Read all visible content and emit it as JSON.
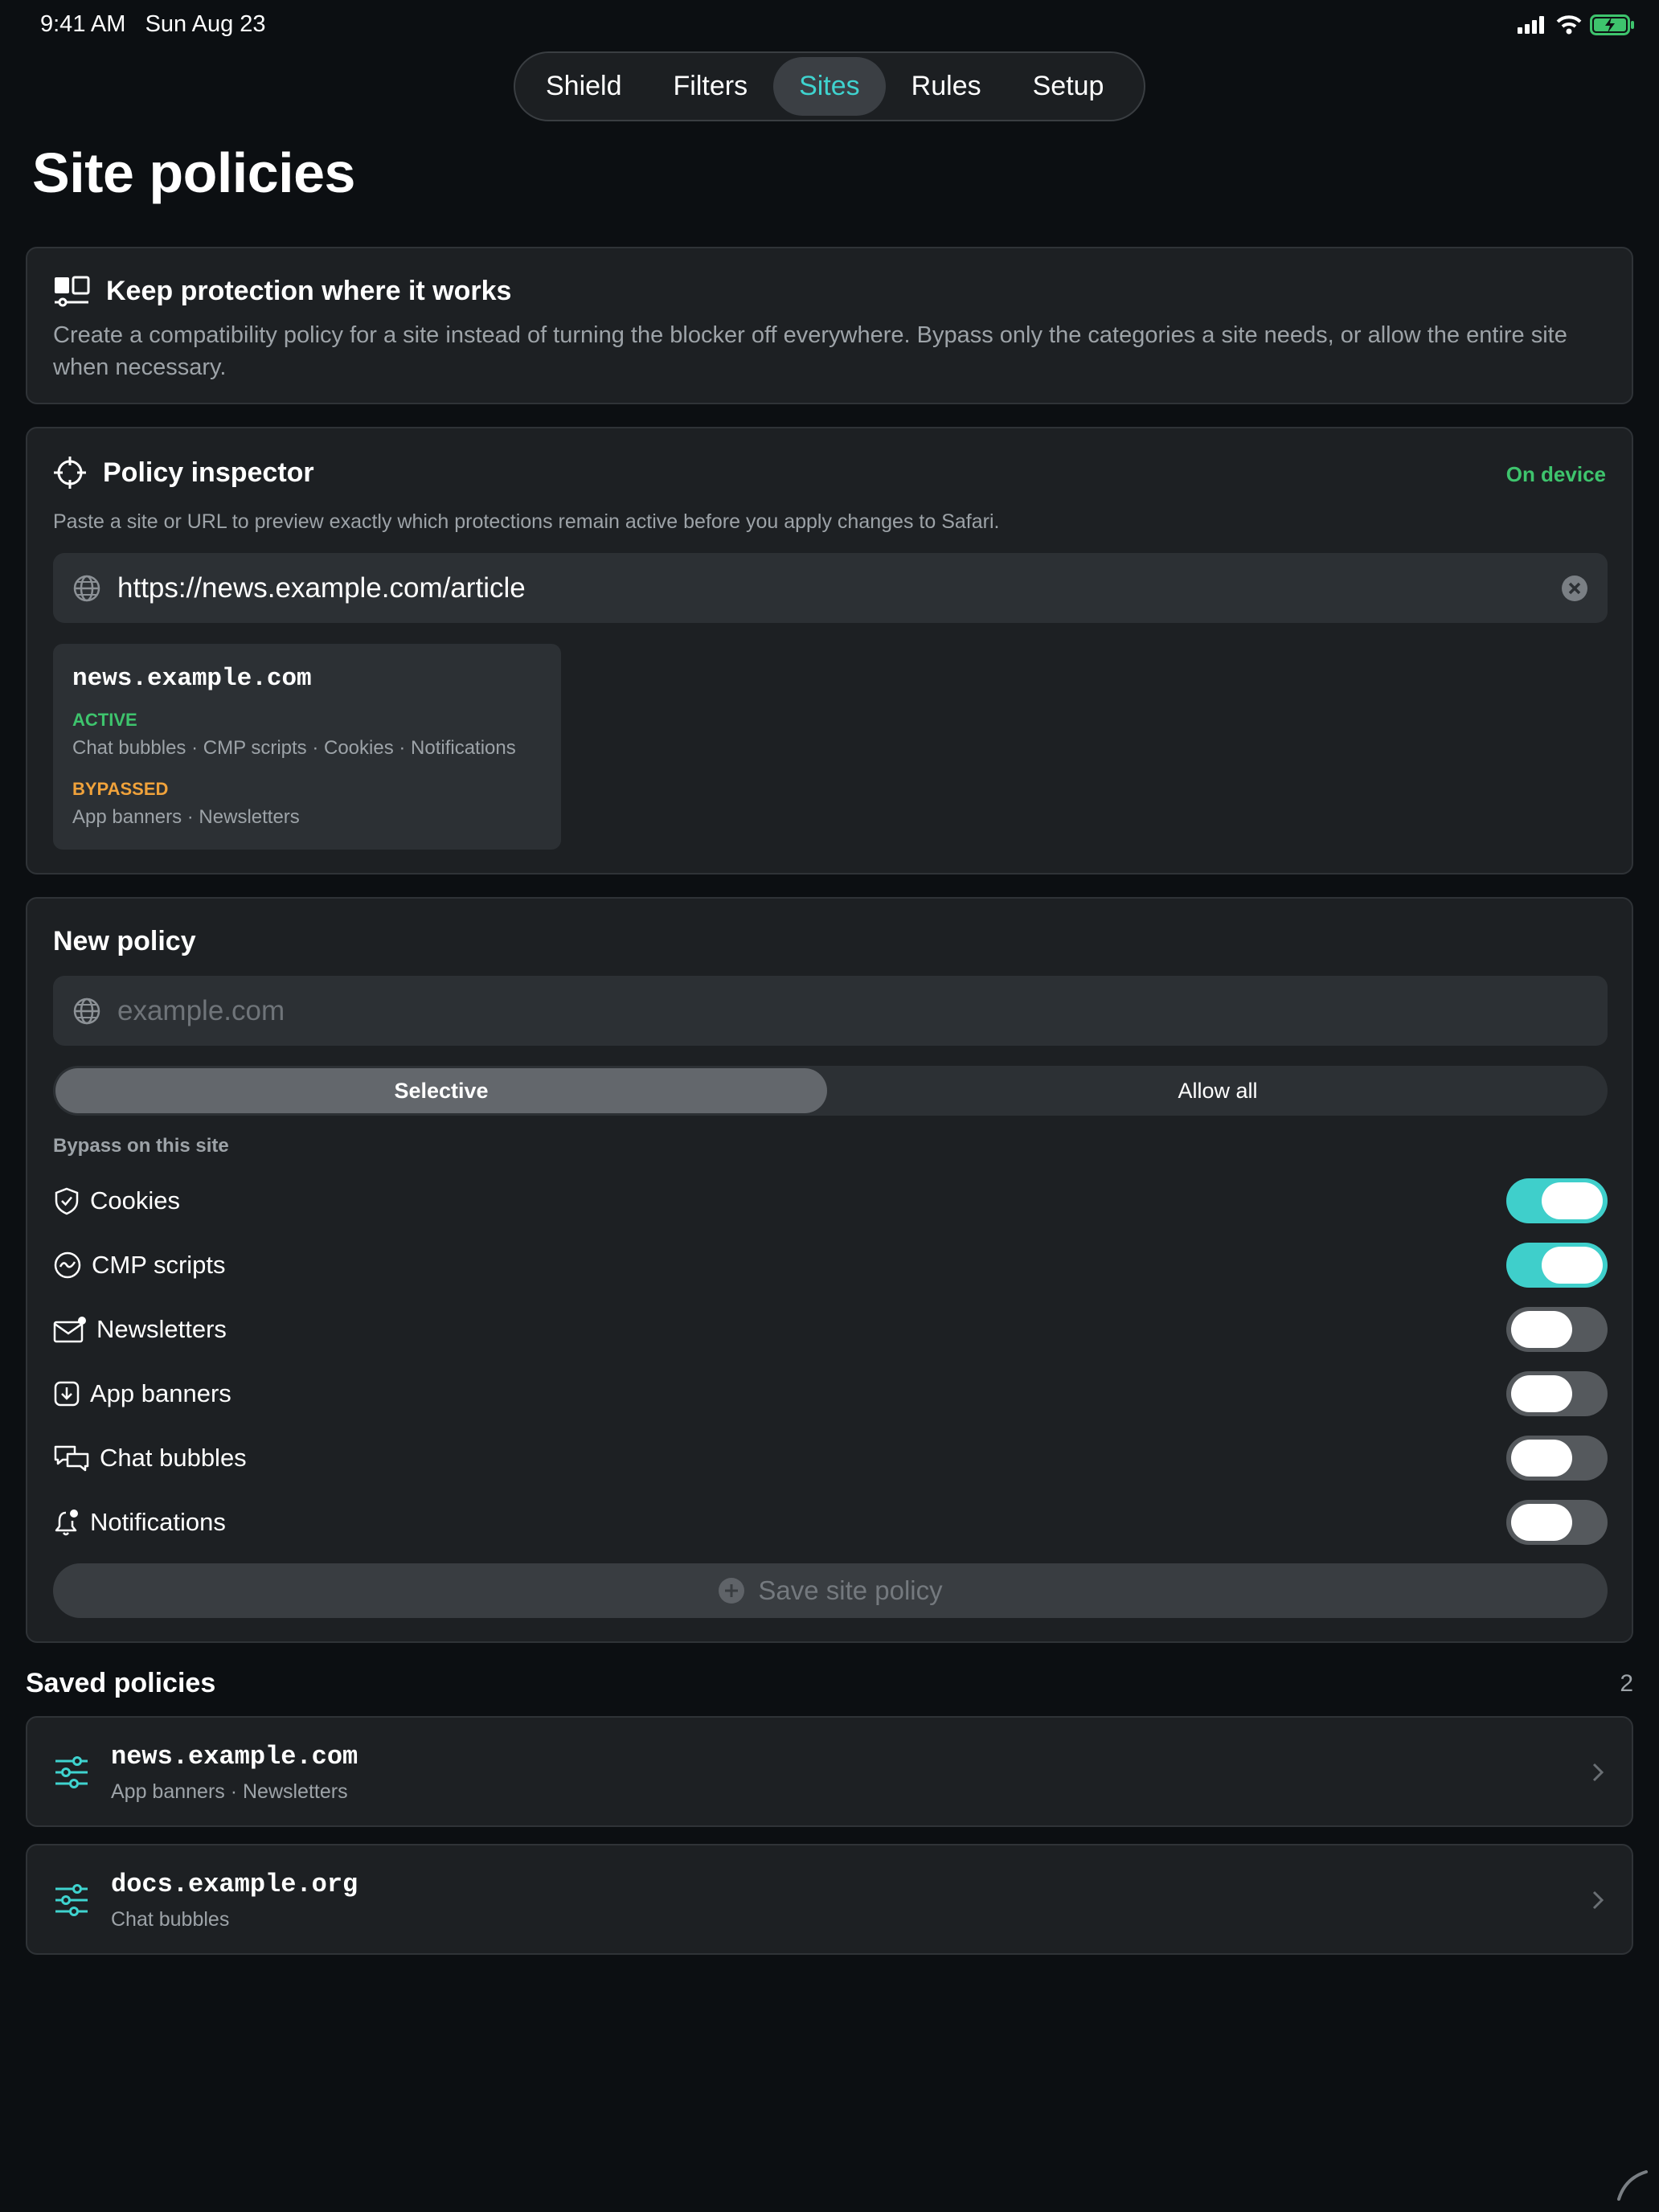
{
  "status": {
    "time": "9:41 AM",
    "date": "Sun Aug 23"
  },
  "tabs": [
    {
      "label": "Shield"
    },
    {
      "label": "Filters"
    },
    {
      "label": "Sites",
      "active": true
    },
    {
      "label": "Rules"
    },
    {
      "label": "Setup"
    }
  ],
  "page": {
    "title": "Site policies"
  },
  "info_card": {
    "title": "Keep protection where it works",
    "body": "Create a compatibility policy for a site instead of turning the blocker off everywhere. Bypass only the categories a site needs, or allow the entire site when necessary."
  },
  "inspector": {
    "title": "Policy inspector",
    "badge": "On device",
    "description": "Paste a site or URL to preview exactly which protections remain active before you apply changes to Safari.",
    "url_value": "https://news.example.com/article",
    "result": {
      "domain": "news.example.com",
      "active_label": "ACTIVE",
      "active_items": "Chat bubbles · CMP scripts · Cookies · Notifications",
      "bypassed_label": "BYPASSED",
      "bypassed_items": "App banners · Newsletters"
    }
  },
  "new_policy": {
    "title": "New policy",
    "domain_placeholder": "example.com",
    "segments": {
      "selective": "Selective",
      "allow_all": "Allow all",
      "selected": "Selective"
    },
    "bypass_heading": "Bypass on this site",
    "bypass_items": [
      {
        "label": "Cookies",
        "icon": "shield-check-icon",
        "on": true
      },
      {
        "label": "CMP scripts",
        "icon": "cmp-wave-icon",
        "on": true
      },
      {
        "label": "Newsletters",
        "icon": "envelope-badge-icon",
        "on": false
      },
      {
        "label": "App banners",
        "icon": "download-square-icon",
        "on": false
      },
      {
        "label": "Chat bubbles",
        "icon": "chat-bubbles-icon",
        "on": false
      },
      {
        "label": "Notifications",
        "icon": "bell-badge-icon",
        "on": false
      }
    ],
    "save_label": "Save site policy"
  },
  "saved": {
    "title": "Saved policies",
    "count": "2",
    "items": [
      {
        "domain": "news.example.com",
        "bypassed": "App banners · Newsletters"
      },
      {
        "domain": "docs.example.org",
        "bypassed": "Chat bubbles"
      }
    ]
  },
  "colors": {
    "accent": "#3fd3cf",
    "active_green": "#3ec46d",
    "bypassed_orange": "#f0a23b",
    "toggle_on": "#3fcfcb"
  }
}
